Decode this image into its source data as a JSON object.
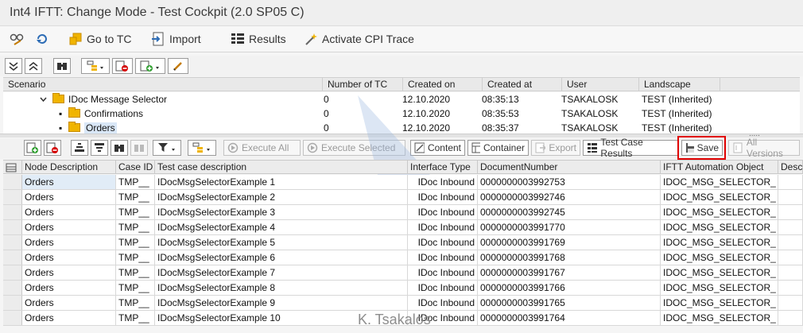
{
  "window": {
    "title": "Int4 IFTT: Change Mode - Test Cockpit (2.0 SP05 C)"
  },
  "app_toolbar": {
    "goto_tc": "Go to TC",
    "import": "Import",
    "results": "Results",
    "activate_cpi": "Activate CPI Trace"
  },
  "tree": {
    "columns": [
      "Scenario",
      "Number of TC",
      "Created on",
      "Created at",
      "User",
      "Landscape"
    ],
    "rows": [
      {
        "name": "IDoc Message Selector",
        "tc": "0",
        "date": "12.10.2020",
        "time": "08:35:13",
        "user": "TSAKALOSK",
        "landscape": "TEST (Inherited)"
      },
      {
        "name": "Confirmations",
        "tc": "0",
        "date": "12.10.2020",
        "time": "08:35:53",
        "user": "TSAKALOSK",
        "landscape": "TEST (Inherited)"
      },
      {
        "name": "Orders",
        "tc": "0",
        "date": "12.10.2020",
        "time": "08:35:37",
        "user": "TSAKALOSK",
        "landscape": "TEST (Inherited)"
      }
    ],
    "more_indicator": "....."
  },
  "table_toolbar": {
    "execute_all": "Execute All",
    "execute_selected": "Execute Selected",
    "content": "Content",
    "container": "Container",
    "export": "Export",
    "test_case_results": "Test Case Results",
    "save": "Save",
    "all_versions": "All Versions"
  },
  "grid": {
    "columns": [
      "Node Description",
      "Case ID",
      "Test case description",
      "Interface Type",
      "DocumentNumber",
      "IFTT Automation Object",
      "Descr"
    ],
    "rows": [
      {
        "node": "Orders",
        "case": "TMP__",
        "desc": "IDocMsgSelectorExample 1",
        "itype": "IDoc Inbound",
        "doc": "0000000003992753",
        "obj": "IDOC_MSG_SELECTOR_"
      },
      {
        "node": "Orders",
        "case": "TMP__",
        "desc": "IDocMsgSelectorExample 2",
        "itype": "IDoc Inbound",
        "doc": "0000000003992746",
        "obj": "IDOC_MSG_SELECTOR_"
      },
      {
        "node": "Orders",
        "case": "TMP__",
        "desc": "IDocMsgSelectorExample 3",
        "itype": "IDoc Inbound",
        "doc": "0000000003992745",
        "obj": "IDOC_MSG_SELECTOR_"
      },
      {
        "node": "Orders",
        "case": "TMP__",
        "desc": "IDocMsgSelectorExample 4",
        "itype": "IDoc Inbound",
        "doc": "0000000003991770",
        "obj": "IDOC_MSG_SELECTOR_"
      },
      {
        "node": "Orders",
        "case": "TMP__",
        "desc": "IDocMsgSelectorExample 5",
        "itype": "IDoc Inbound",
        "doc": "0000000003991769",
        "obj": "IDOC_MSG_SELECTOR_"
      },
      {
        "node": "Orders",
        "case": "TMP__",
        "desc": "IDocMsgSelectorExample 6",
        "itype": "IDoc Inbound",
        "doc": "0000000003991768",
        "obj": "IDOC_MSG_SELECTOR_"
      },
      {
        "node": "Orders",
        "case": "TMP__",
        "desc": "IDocMsgSelectorExample 7",
        "itype": "IDoc Inbound",
        "doc": "0000000003991767",
        "obj": "IDOC_MSG_SELECTOR_"
      },
      {
        "node": "Orders",
        "case": "TMP__",
        "desc": "IDocMsgSelectorExample 8",
        "itype": "IDoc Inbound",
        "doc": "0000000003991766",
        "obj": "IDOC_MSG_SELECTOR_"
      },
      {
        "node": "Orders",
        "case": "TMP__",
        "desc": "IDocMsgSelectorExample 9",
        "itype": "IDoc Inbound",
        "doc": "0000000003991765",
        "obj": "IDOC_MSG_SELECTOR_"
      },
      {
        "node": "Orders",
        "case": "TMP__",
        "desc": "IDocMsgSelectorExample 10",
        "itype": "IDoc Inbound",
        "doc": "0000000003991764",
        "obj": "IDOC_MSG_SELECTOR_"
      }
    ]
  },
  "watermark": "K. Tsakalos",
  "colors": {
    "highlight": "#e00000",
    "folder": "#f0b400",
    "selection": "#d9e7f7"
  }
}
